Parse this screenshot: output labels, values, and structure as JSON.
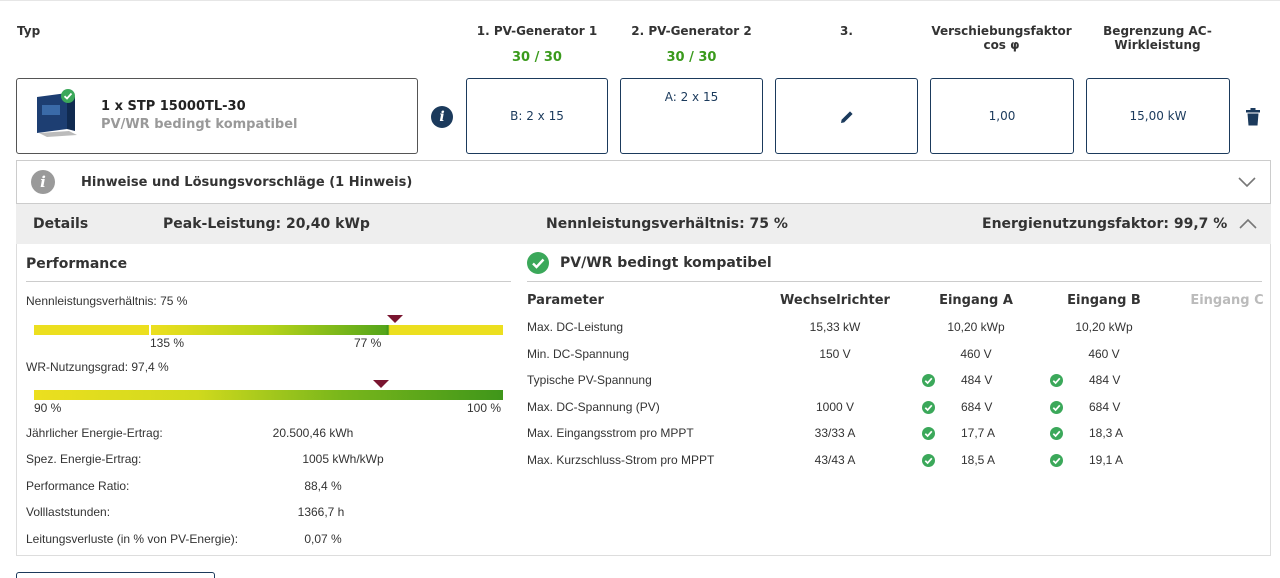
{
  "header": {
    "typ": "Typ",
    "pv1_title": "1. PV-Generator 1",
    "pv1_count": "30 / 30",
    "pv2_title": "2. PV-Generator 2",
    "pv2_count": "30 / 30",
    "col3_title": "3.",
    "shift_title_1": "Verschiebungsfaktor",
    "shift_title_2": "cos φ",
    "limit_title_1": "Begrenzung AC-",
    "limit_title_2": "Wirkleistung"
  },
  "inverter": {
    "name": "1 x STP 15000TL-30",
    "status": "PV/WR bedingt kompatibel",
    "pv1_config": "B: 2 x 15",
    "pv2_config": "A: 2 x 15",
    "cos_phi": "1,00",
    "ac_limit": "15,00 kW"
  },
  "hints": {
    "label": "Hinweise und Lösungsvorschläge (1 Hinweis)"
  },
  "details": {
    "label": "Details",
    "peak": "Peak-Leistung: 20,40 kWp",
    "ratio": "Nennleistungsverhältnis: 75 %",
    "energy_factor": "Energienutzungsfaktor: 99,7 %"
  },
  "performance": {
    "title": "Performance",
    "ratio_label": "Nennleistungsverhältnis: 75 %",
    "ratio_scale_left": "135 %",
    "ratio_scale_right": "77 %",
    "ratio_marker_pct": 77,
    "wr_label": "WR-Nutzungsgrad: 97,4 %",
    "wr_scale_left": "90 %",
    "wr_scale_right": "100 %",
    "wr_marker_pct": 74,
    "rows": [
      {
        "label": "Jährlicher Energie-Ertrag:",
        "value": "20.500,46 kWh"
      },
      {
        "label": "Spez. Energie-Ertrag:",
        "value": "1005 kWh/kWp"
      },
      {
        "label": "Performance Ratio:",
        "value": "88,4 %"
      },
      {
        "label": "Volllaststunden:",
        "value": "1366,7 h"
      },
      {
        "label": "Leitungsverluste (in % von PV-Energie):",
        "value": "0,07 %"
      }
    ]
  },
  "compat": {
    "title": "PV/WR bedingt kompatibel",
    "headers": [
      "Parameter",
      "Wechselrichter",
      "Eingang A",
      "Eingang B",
      "Eingang C"
    ],
    "rows": [
      {
        "param": "Max. DC-Leistung",
        "wr": "15,33 kW",
        "a": "10,20 kWp",
        "b": "10,20 kWp",
        "check": false
      },
      {
        "param": "Min. DC-Spannung",
        "wr": "150 V",
        "a": "460 V",
        "b": "460 V",
        "check": false
      },
      {
        "param": "Typische PV-Spannung",
        "wr": "",
        "a": "484 V",
        "b": "484 V",
        "check": true
      },
      {
        "param": "Max. DC-Spannung (PV)",
        "wr": "1000 V",
        "a": "684 V",
        "b": "684 V",
        "check": true
      },
      {
        "param": "Max. Eingangsstrom pro MPPT",
        "wr": "33/33 A",
        "a": "17,7 A",
        "b": "18,3 A",
        "check": true
      },
      {
        "param": "Max. Kurzschluss-Strom pro MPPT",
        "wr": "43/43 A",
        "a": "18,5 A",
        "b": "19,1 A",
        "check": true
      }
    ]
  },
  "colors": {
    "navy": "#1b3a5c",
    "green": "#3a9a1c",
    "check": "#3ba85a",
    "marker": "#7a1530"
  }
}
